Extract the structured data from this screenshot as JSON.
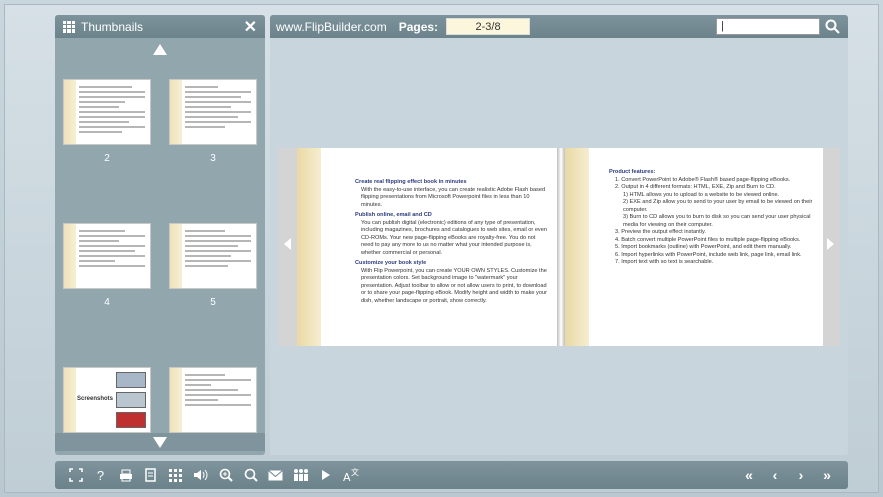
{
  "thumbnails": {
    "title": "Thumbnails",
    "items": [
      {
        "num": "2"
      },
      {
        "num": "3"
      },
      {
        "num": "4"
      },
      {
        "num": "5"
      },
      {
        "num": "Screenshots"
      },
      {
        "num": ""
      }
    ]
  },
  "topbar": {
    "site": "www.FlipBuilder.com",
    "pages_label": "Pages:",
    "pages_value": "2-3/8"
  },
  "left_page": {
    "h1": "Create real flipping effect book in minutes",
    "p1": "With the easy-to-use interface, you can create realistic Adobe Flash based flipping presentations from Microsoft Powerpoint files in less than 10 minutes.",
    "h2": "Publish online, email and CD",
    "p2": "You can publish digital (electronic) editions of any type of presentation, including magazines, brochures and catalogues to web sites, email or even CD-ROMs. Your new page-flipping eBooks are royalty-free. You do not need to pay any more to us no matter what your intended purpose is, whether commercial or personal.",
    "h3": "Customize your book style",
    "p3": "With Flip Powerpoint, you can create YOUR OWN STYLES. Customize the presentation colors. Set background image to \"watermark\" your presentation. Adjust toolbar to allow or not allow users to print, to download or to share your page-flipping eBook. Modify height and width to make your dish, whether landscape or portrait, show correctly."
  },
  "right_page": {
    "title": "Product features:",
    "items": [
      "1. Convert PowerPoint to Adobe® Flash® based page-flipping eBooks.",
      "2. Output in 4 different formats: HTML, EXE, Zip and Burn to CD.",
      "1) HTML allows you to upload to a website to be viewed online.",
      "2) EXE and Zip allow you to send to your user by email to be viewed on their computer.",
      "3) Burn to CD allows you to burn to disk so you can send your user physical media for viewing on their computer.",
      "3. Preview the output effect instantly.",
      "4. Batch convert multiple PowerPoint files to multiple page-flipping eBooks.",
      "5. Import bookmarks (outline) with PowerPoint, and edit them manually.",
      "6. Import hyperlinks with PowerPoint, include web link, page link, email link.",
      "7. Import text with so text is searchable."
    ]
  },
  "thumb_labels": {
    "screenshots": "Screenshots"
  }
}
